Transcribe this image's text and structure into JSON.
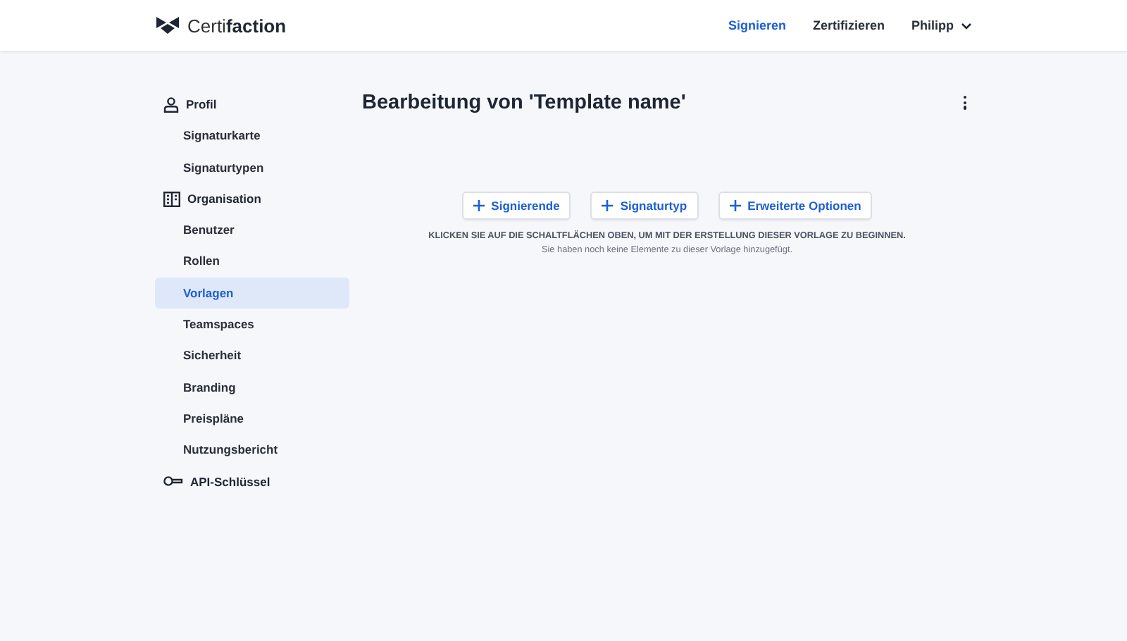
{
  "header": {
    "logo": "Certi**faction**",
    "nav": [
      {
        "label": "Signieren",
        "selected": true
      },
      {
        "label": "Zertifizieren",
        "selected": false
      }
    ],
    "user": "Philipp"
  },
  "sidebar": {
    "sections": [
      {
        "label": "Profil",
        "children": [
          {
            "label": "Signaturkarte",
            "selected": false
          },
          {
            "label": "Signaturtypen",
            "selected": false
          }
        ]
      },
      {
        "label": "Organisation",
        "children": [
          {
            "label": "Benutzer",
            "selected": false
          },
          {
            "label": "Rollen",
            "selected": false
          },
          {
            "label": "Vorlagen",
            "selected": true
          },
          {
            "label": "Teamspaces",
            "selected": false
          },
          {
            "label": "Sicherheit",
            "selected": false
          },
          {
            "label": "Branding",
            "selected": false
          },
          {
            "label": "Preispläne",
            "selected": false
          },
          {
            "label": "Nutzungsbericht",
            "selected": false
          }
        ]
      },
      {
        "label": "API-Schlüssel"
      }
    ]
  },
  "main": {
    "title": "Bearbeitung von 'Template name'",
    "add_buttons": [
      "Signierende",
      "Signaturtyp",
      "Erweiterte Optionen"
    ],
    "instruction": "KLICKEN SIE AUF DIE SCHALTFLÄCHEN OBEN, UM MIT DER ERSTELLUNG DIESER VORLAGE ZU BEGINNEN.",
    "empty_note": "Sie haben noch keine Elemente zu dieser Vorlage hinzugefügt."
  }
}
